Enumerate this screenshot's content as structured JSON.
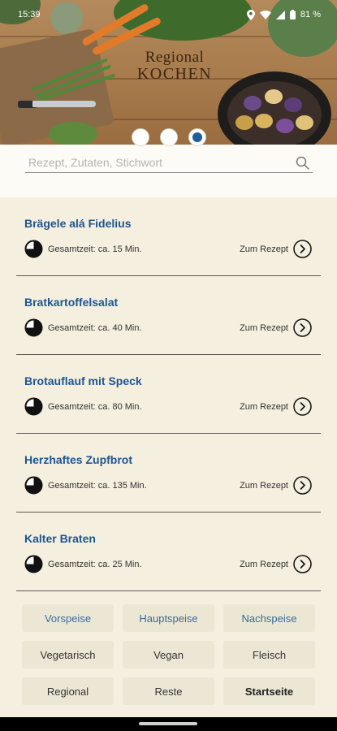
{
  "status_bar": {
    "time": "15:39",
    "battery": "81 %"
  },
  "brand": {
    "line1": "Regional",
    "line2": "KOCHEN"
  },
  "pager": {
    "count": 3,
    "active_index": 2
  },
  "search": {
    "placeholder": "Rezept, Zutaten, Stichwort",
    "value": ""
  },
  "recipes": [
    {
      "title": "Brägele alá Fidelius",
      "time": "Gesamtzeit: ca. 15 Min.",
      "link": "Zum Rezept",
      "progress": 0.75
    },
    {
      "title": "Bratkartoffelsalat",
      "time": "Gesamtzeit: ca. 40 Min.",
      "link": "Zum Rezept",
      "progress": 0.75
    },
    {
      "title": "Brotauflauf mit Speck",
      "time": "Gesamtzeit: ca. 80 Min.",
      "link": "Zum Rezept",
      "progress": 0.75
    },
    {
      "title": "Herzhaftes Zupfbrot",
      "time": "Gesamtzeit: ca. 135 Min.",
      "link": "Zum Rezept",
      "progress": 0.75
    },
    {
      "title": "Kalter Braten",
      "time": "Gesamtzeit: ca. 25 Min.",
      "link": "Zum Rezept",
      "progress": 0.75
    }
  ],
  "categories": [
    {
      "label": "Vorspeise",
      "style": "blue"
    },
    {
      "label": "Hauptspeise",
      "style": "blue"
    },
    {
      "label": "Nachspeise",
      "style": "blue"
    },
    {
      "label": "Vegetarisch",
      "style": "plain"
    },
    {
      "label": "Vegan",
      "style": "plain"
    },
    {
      "label": "Fleisch",
      "style": "plain"
    },
    {
      "label": "Regional",
      "style": "plain"
    },
    {
      "label": "Reste",
      "style": "plain"
    },
    {
      "label": "Startseite",
      "style": "start"
    }
  ],
  "colors": {
    "accent": "#1f5590",
    "background": "#f4efdf",
    "button": "#ece7d5"
  }
}
